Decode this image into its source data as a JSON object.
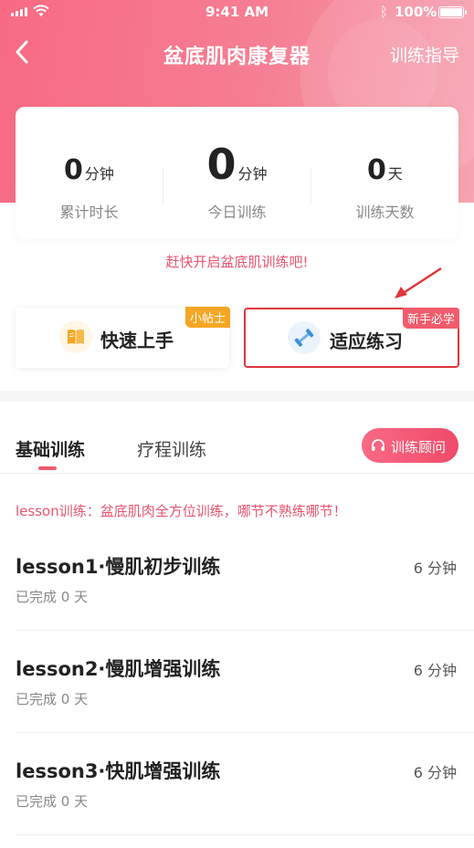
{
  "status_bar": {
    "time": "9:41 AM",
    "battery": "100%"
  },
  "nav": {
    "title": "盆底肌肉康复器",
    "guide": "训练指导"
  },
  "stats": [
    {
      "value": "0",
      "unit": "分钟",
      "label": "累计时长"
    },
    {
      "value": "0",
      "unit": "分钟",
      "label": "今日训练"
    },
    {
      "value": "0",
      "unit": "天",
      "label": "训练天数"
    }
  ],
  "promo": "赶快开启盆底肌训练吧!",
  "cards": {
    "quick": {
      "label": "快速上手",
      "badge": "小帖士"
    },
    "adapt": {
      "label": "适应练习",
      "badge": "新手必学"
    }
  },
  "tabs": [
    {
      "label": "基础训练"
    },
    {
      "label": "疗程训练"
    }
  ],
  "consult": {
    "label": "训练顾问"
  },
  "tip": "lesson训练：盆底肌肉全方位训练，哪节不熟练哪节！",
  "lessons": [
    {
      "name": "lesson1·慢肌初步训练",
      "duration": "6 分钟",
      "status": "已完成 0 天"
    },
    {
      "name": "lesson2·慢肌增强训练",
      "duration": "6 分钟",
      "status": "已完成 0 天"
    },
    {
      "name": "lesson3·快肌增强训练",
      "duration": "6 分钟",
      "status": "已完成 0 天"
    }
  ],
  "colors": {
    "accent": "#f15b6c",
    "highlight_border": "#e0353a",
    "badge_orange": "#f5a623"
  }
}
